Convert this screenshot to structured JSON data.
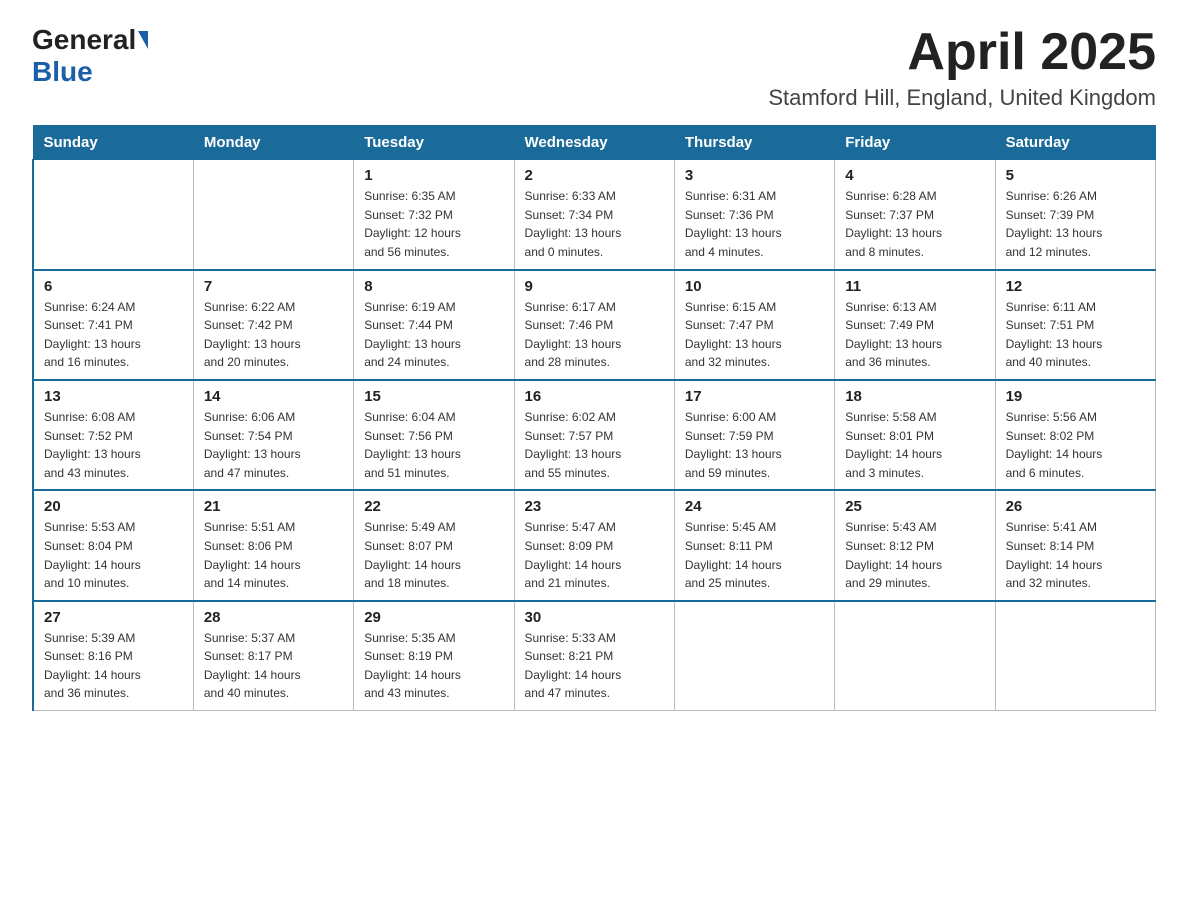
{
  "header": {
    "logo_general": "General",
    "logo_blue": "Blue",
    "title": "April 2025",
    "location": "Stamford Hill, England, United Kingdom"
  },
  "days_of_week": [
    "Sunday",
    "Monday",
    "Tuesday",
    "Wednesday",
    "Thursday",
    "Friday",
    "Saturday"
  ],
  "weeks": [
    [
      {
        "day": "",
        "info": ""
      },
      {
        "day": "",
        "info": ""
      },
      {
        "day": "1",
        "info": "Sunrise: 6:35 AM\nSunset: 7:32 PM\nDaylight: 12 hours\nand 56 minutes."
      },
      {
        "day": "2",
        "info": "Sunrise: 6:33 AM\nSunset: 7:34 PM\nDaylight: 13 hours\nand 0 minutes."
      },
      {
        "day": "3",
        "info": "Sunrise: 6:31 AM\nSunset: 7:36 PM\nDaylight: 13 hours\nand 4 minutes."
      },
      {
        "day": "4",
        "info": "Sunrise: 6:28 AM\nSunset: 7:37 PM\nDaylight: 13 hours\nand 8 minutes."
      },
      {
        "day": "5",
        "info": "Sunrise: 6:26 AM\nSunset: 7:39 PM\nDaylight: 13 hours\nand 12 minutes."
      }
    ],
    [
      {
        "day": "6",
        "info": "Sunrise: 6:24 AM\nSunset: 7:41 PM\nDaylight: 13 hours\nand 16 minutes."
      },
      {
        "day": "7",
        "info": "Sunrise: 6:22 AM\nSunset: 7:42 PM\nDaylight: 13 hours\nand 20 minutes."
      },
      {
        "day": "8",
        "info": "Sunrise: 6:19 AM\nSunset: 7:44 PM\nDaylight: 13 hours\nand 24 minutes."
      },
      {
        "day": "9",
        "info": "Sunrise: 6:17 AM\nSunset: 7:46 PM\nDaylight: 13 hours\nand 28 minutes."
      },
      {
        "day": "10",
        "info": "Sunrise: 6:15 AM\nSunset: 7:47 PM\nDaylight: 13 hours\nand 32 minutes."
      },
      {
        "day": "11",
        "info": "Sunrise: 6:13 AM\nSunset: 7:49 PM\nDaylight: 13 hours\nand 36 minutes."
      },
      {
        "day": "12",
        "info": "Sunrise: 6:11 AM\nSunset: 7:51 PM\nDaylight: 13 hours\nand 40 minutes."
      }
    ],
    [
      {
        "day": "13",
        "info": "Sunrise: 6:08 AM\nSunset: 7:52 PM\nDaylight: 13 hours\nand 43 minutes."
      },
      {
        "day": "14",
        "info": "Sunrise: 6:06 AM\nSunset: 7:54 PM\nDaylight: 13 hours\nand 47 minutes."
      },
      {
        "day": "15",
        "info": "Sunrise: 6:04 AM\nSunset: 7:56 PM\nDaylight: 13 hours\nand 51 minutes."
      },
      {
        "day": "16",
        "info": "Sunrise: 6:02 AM\nSunset: 7:57 PM\nDaylight: 13 hours\nand 55 minutes."
      },
      {
        "day": "17",
        "info": "Sunrise: 6:00 AM\nSunset: 7:59 PM\nDaylight: 13 hours\nand 59 minutes."
      },
      {
        "day": "18",
        "info": "Sunrise: 5:58 AM\nSunset: 8:01 PM\nDaylight: 14 hours\nand 3 minutes."
      },
      {
        "day": "19",
        "info": "Sunrise: 5:56 AM\nSunset: 8:02 PM\nDaylight: 14 hours\nand 6 minutes."
      }
    ],
    [
      {
        "day": "20",
        "info": "Sunrise: 5:53 AM\nSunset: 8:04 PM\nDaylight: 14 hours\nand 10 minutes."
      },
      {
        "day": "21",
        "info": "Sunrise: 5:51 AM\nSunset: 8:06 PM\nDaylight: 14 hours\nand 14 minutes."
      },
      {
        "day": "22",
        "info": "Sunrise: 5:49 AM\nSunset: 8:07 PM\nDaylight: 14 hours\nand 18 minutes."
      },
      {
        "day": "23",
        "info": "Sunrise: 5:47 AM\nSunset: 8:09 PM\nDaylight: 14 hours\nand 21 minutes."
      },
      {
        "day": "24",
        "info": "Sunrise: 5:45 AM\nSunset: 8:11 PM\nDaylight: 14 hours\nand 25 minutes."
      },
      {
        "day": "25",
        "info": "Sunrise: 5:43 AM\nSunset: 8:12 PM\nDaylight: 14 hours\nand 29 minutes."
      },
      {
        "day": "26",
        "info": "Sunrise: 5:41 AM\nSunset: 8:14 PM\nDaylight: 14 hours\nand 32 minutes."
      }
    ],
    [
      {
        "day": "27",
        "info": "Sunrise: 5:39 AM\nSunset: 8:16 PM\nDaylight: 14 hours\nand 36 minutes."
      },
      {
        "day": "28",
        "info": "Sunrise: 5:37 AM\nSunset: 8:17 PM\nDaylight: 14 hours\nand 40 minutes."
      },
      {
        "day": "29",
        "info": "Sunrise: 5:35 AM\nSunset: 8:19 PM\nDaylight: 14 hours\nand 43 minutes."
      },
      {
        "day": "30",
        "info": "Sunrise: 5:33 AM\nSunset: 8:21 PM\nDaylight: 14 hours\nand 47 minutes."
      },
      {
        "day": "",
        "info": ""
      },
      {
        "day": "",
        "info": ""
      },
      {
        "day": "",
        "info": ""
      }
    ]
  ]
}
